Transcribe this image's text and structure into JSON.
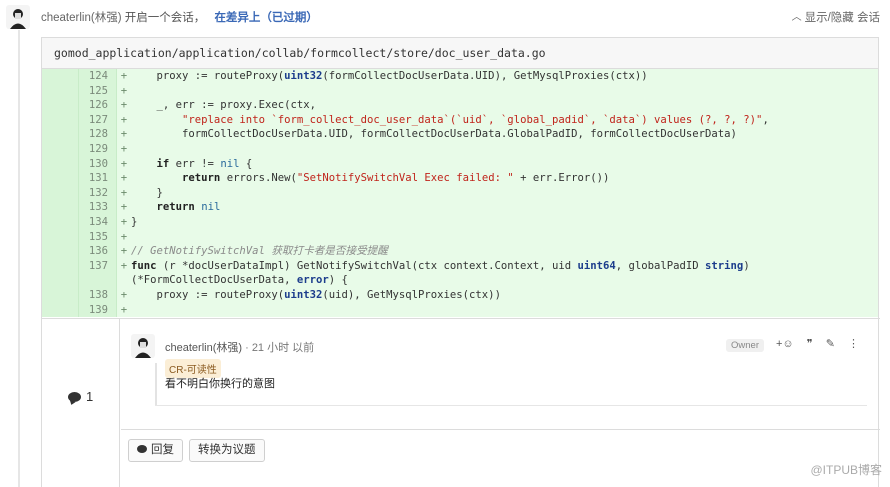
{
  "header": {
    "user": "cheaterlin(林强)",
    "action": "开启一个会话，",
    "link": "在差异上（已过期）",
    "toggle_label": "显示/隐藏 会话"
  },
  "file": {
    "path": "gomod_application/application/collab/formcollect/store/doc_user_data.go"
  },
  "code_lines": [
    {
      "num": "124",
      "sign": "+"
    },
    {
      "num": "125",
      "sign": "+"
    },
    {
      "num": "126",
      "sign": "+"
    },
    {
      "num": "127",
      "sign": "+"
    },
    {
      "num": "128",
      "sign": "+"
    },
    {
      "num": "129",
      "sign": "+"
    },
    {
      "num": "130",
      "sign": "+"
    },
    {
      "num": "131",
      "sign": "+"
    },
    {
      "num": "132",
      "sign": "+"
    },
    {
      "num": "133",
      "sign": "+"
    },
    {
      "num": "134",
      "sign": "+"
    },
    {
      "num": "135",
      "sign": "+"
    },
    {
      "num": "136",
      "sign": "+"
    },
    {
      "num": "137",
      "sign": "+"
    },
    {
      "num": "138",
      "sign": "+"
    },
    {
      "num": "139",
      "sign": "+"
    }
  ],
  "code": {
    "l124_a": "    proxy := routeProxy(",
    "l124_b": "uint32",
    "l124_c": "(formCollectDocUserData.UID), GetMysqlProxies(ctx))",
    "l126": "    _, err := proxy.Exec(ctx,",
    "l127_str": "\"replace into `form_collect_doc_user_data`(`uid`, `global_padid`, `data`) values (?, ?, ?)\"",
    "l127_tail": ",",
    "l128": "        formCollectDocUserData.UID, formCollectDocUserData.GlobalPadID, formCollectDocUserData)",
    "l130_a": "if",
    "l130_b": " err != ",
    "l130_c": "nil",
    "l130_d": " {",
    "l131_a": "return",
    "l131_b": " errors.New(",
    "l131_c": "\"SetNotifySwitchVal Exec failed: \"",
    "l131_d": " + err.Error())",
    "l132": "    }",
    "l133_a": "return",
    "l133_b": "nil",
    "l134": "}",
    "l136": "// GetNotifySwitchVal 获取打卡者是否接受提醒",
    "l137_a": "func",
    "l137_b": " (r *docUserDataImpl) GetNotifySwitchVal(ctx context.Context, uid ",
    "l137_c": "uint64",
    "l137_d": ", globalPadID ",
    "l137_e": "string",
    "l137_f": ") (*FormCollectDocUserData, ",
    "l137_g": "error",
    "l137_h": ") {",
    "l138_a": "    proxy := routeProxy(",
    "l138_b": "uint32",
    "l138_c": "(uid), GetMysqlProxies(ctx))"
  },
  "comment": {
    "count": "1",
    "author": "cheaterlin(林强)",
    "time": "· 21 小时 以前",
    "owner_badge": "Owner",
    "tag": "CR-可读性",
    "body": "看不明白你换行的意图",
    "actions": {
      "react": "+☺",
      "quote": "❞",
      "edit": "✎",
      "more": "⋮"
    }
  },
  "buttons": {
    "reply": "回复",
    "to_topic": "转换为议题"
  },
  "watermark": "@ITPUB博客"
}
